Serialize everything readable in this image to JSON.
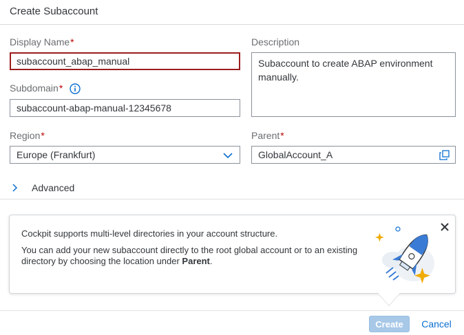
{
  "dialog": {
    "title": "Create Subaccount"
  },
  "form": {
    "display_name": {
      "label": "Display Name",
      "required_mark": "*",
      "value": "subaccount_abap_manual"
    },
    "subdomain": {
      "label": "Subdomain",
      "required_mark": "*",
      "value": "subaccount-abap-manual-12345678"
    },
    "region": {
      "label": "Region",
      "required_mark": "*",
      "value": "Europe (Frankfurt)"
    },
    "description": {
      "label": "Description",
      "value": "Subaccount to create ABAP environment manually."
    },
    "parent": {
      "label": "Parent",
      "required_mark": "*",
      "value": "GlobalAccount_A"
    },
    "advanced_label": "Advanced"
  },
  "info_popover": {
    "line1": "Cockpit supports multi-level directories in your account structure.",
    "line2_prefix": "You can add your new subaccount directly to the root global account or to an existing directory by choosing the location under ",
    "line2_bold": "Parent",
    "line2_suffix": "."
  },
  "footer": {
    "create_label": "Create",
    "cancel_label": "Cancel"
  },
  "colors": {
    "required": "#bb0000",
    "error_border": "#9b1d1d",
    "primary_disabled": "#a8c8e8",
    "link": "#0a6ed1",
    "icon_blue": "#0a6ed1"
  },
  "icons": [
    "info-icon",
    "chevron-down-icon",
    "copy-icon",
    "chevron-right-icon",
    "close-icon",
    "rocket-illustration"
  ]
}
